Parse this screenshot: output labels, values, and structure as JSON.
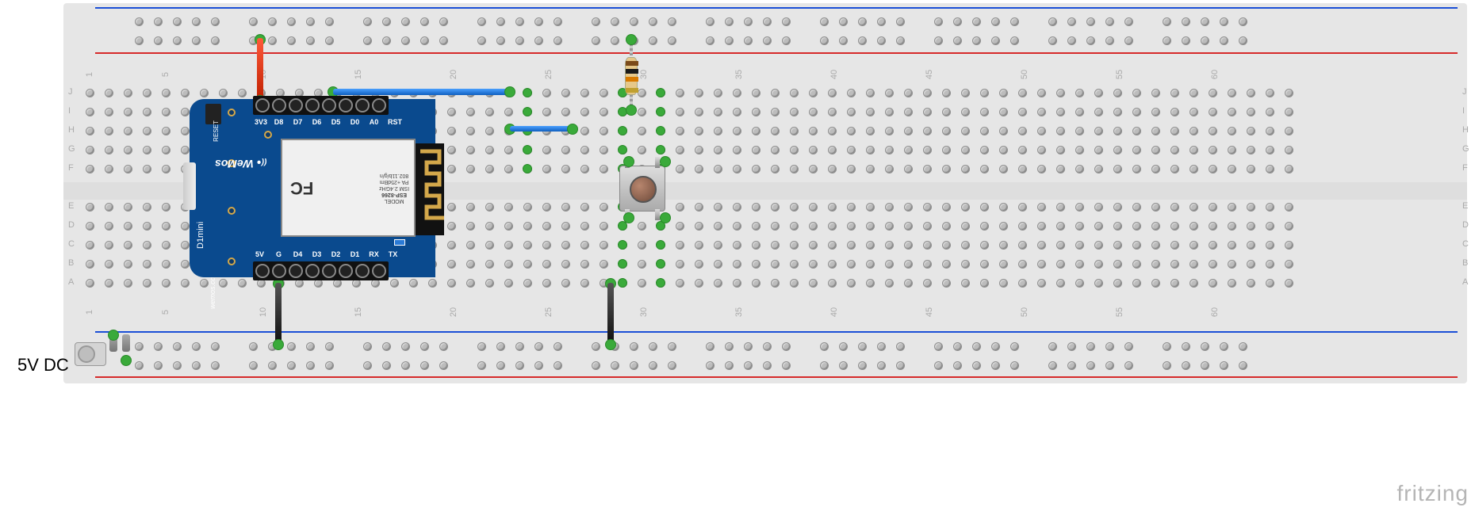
{
  "power_label": "5V DC",
  "watermark": "fritzing",
  "breadboard": {
    "row_labels_left": [
      "J",
      "I",
      "H",
      "G",
      "F",
      "E",
      "D",
      "C",
      "B",
      "A"
    ],
    "row_labels_right": [
      "J",
      "I",
      "H",
      "G",
      "F",
      "E",
      "D",
      "C",
      "B",
      "A"
    ],
    "col_labels": [
      "1",
      "5",
      "10",
      "15",
      "20",
      "25",
      "30",
      "35",
      "40",
      "45",
      "50",
      "55",
      "60"
    ]
  },
  "board": {
    "name": "WeMos D1 mini",
    "chip": "ESP-8266",
    "pins_top": [
      "3V3",
      "D8",
      "D7",
      "D6",
      "D5",
      "D0",
      "A0",
      "RST"
    ],
    "pins_bottom": [
      "5V",
      "G",
      "D4",
      "D3",
      "D2",
      "D1",
      "RX",
      "TX"
    ],
    "logo": "WeMos",
    "model": "D1mini",
    "url": "wemos.cc",
    "reset": "RESET",
    "chip_lines": [
      "MODEL",
      "ESP-8266",
      "ISM 2.4GHz",
      "PA +25dBm",
      "802.11b/g/n"
    ],
    "fc": "FC"
  },
  "components": {
    "pushbutton": "tactile-button",
    "resistor": "10k-resistor",
    "dc_jack": "dc-barrel-jack"
  },
  "wires": [
    {
      "name": "3v3-to-plus-rail",
      "color": "red"
    },
    {
      "name": "d5-to-button-col",
      "color": "blue"
    },
    {
      "name": "button-to-resistor",
      "color": "blue"
    },
    {
      "name": "g-to-minus-rail",
      "color": "black"
    },
    {
      "name": "button-to-minus-rail",
      "color": "black"
    }
  ]
}
